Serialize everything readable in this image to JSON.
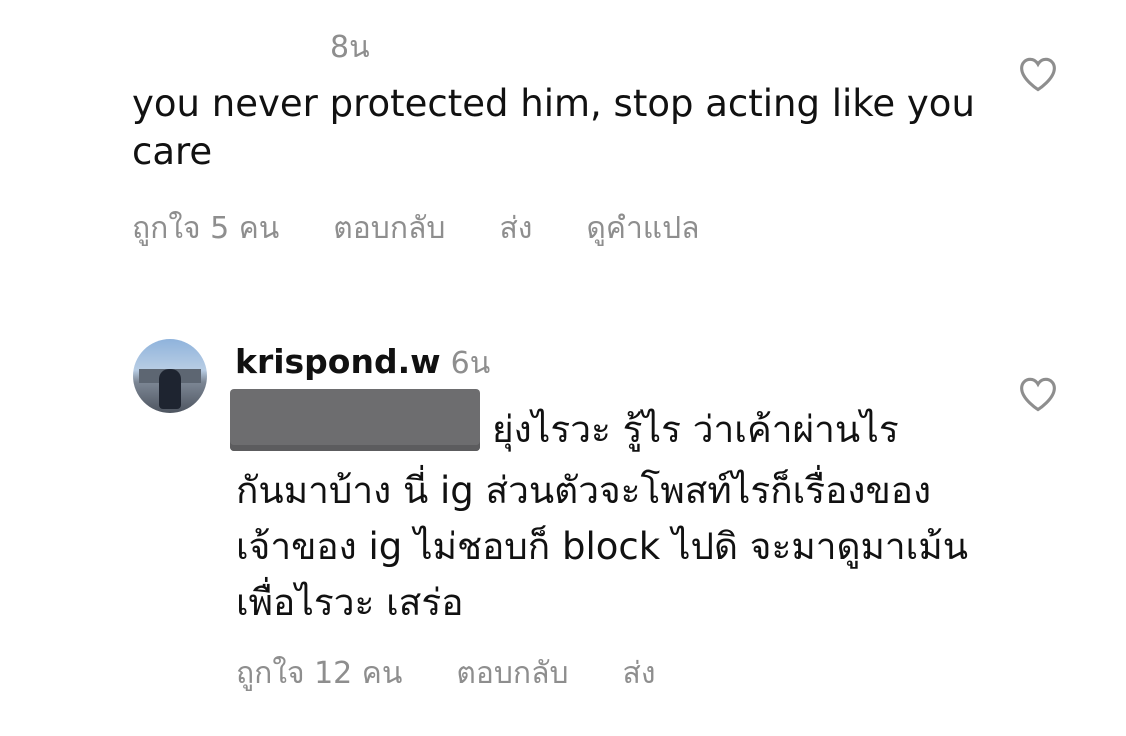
{
  "comments": [
    {
      "time": "8น",
      "text": "you never protected him, stop acting like you care",
      "actions": {
        "likes": "ถูกใจ 5 คน",
        "reply": "ตอบกลับ",
        "send": "ส่ง",
        "translate": "ดูคำแปล"
      },
      "icons": {
        "like": "heart-outline-icon"
      }
    },
    {
      "username": "krispond.w",
      "time": "6น",
      "text_line1": "ยุ่งไรวะ รู้ไร ว่าเค้าผ่านไร",
      "text_rest": "กันมาบ้าง นี่ ig ส่วนตัวจะโพสท์ไรก็เรื่องของเจ้าของ ig ไม่ชอบก็ block ไปดิ จะมาดูมาเม้นเพื่อไรวะ เสร่อ",
      "actions": {
        "likes": "ถูกใจ 12 คน",
        "reply": "ตอบกลับ",
        "send": "ส่ง"
      },
      "icons": {
        "like": "heart-outline-icon",
        "avatar": "profile-avatar"
      }
    }
  ],
  "colors": {
    "text": "#111111",
    "meta": "#8e8e8e",
    "redaction": "#6d6d6f"
  }
}
